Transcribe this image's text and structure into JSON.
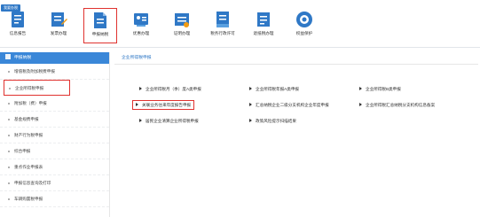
{
  "corner_tag": "我要办税",
  "toolbar": [
    {
      "label": "信息报告",
      "icon": "info-report-icon"
    },
    {
      "label": "发票办理",
      "icon": "invoice-icon"
    },
    {
      "label": "申报纳税",
      "icon": "tax-declare-icon"
    },
    {
      "label": "优惠办理",
      "icon": "preferential-icon"
    },
    {
      "label": "证明办理",
      "icon": "certificate-icon"
    },
    {
      "label": "税务行政许可",
      "icon": "admin-license-icon"
    },
    {
      "label": "退抵税办理",
      "icon": "refund-icon"
    },
    {
      "label": "权益保护",
      "icon": "rights-protection-icon"
    }
  ],
  "sidebar": {
    "title": "申报纳税",
    "items": [
      {
        "label": "增值税及附加税费申报"
      },
      {
        "label": "企业所得税申报"
      },
      {
        "label": "附加税（费）申报"
      },
      {
        "label": "基金规费申报"
      },
      {
        "label": "财产行为税申报"
      },
      {
        "label": "综合申报"
      },
      {
        "label": "重点作业申报表"
      },
      {
        "label": "申报信息查询及打印"
      },
      {
        "label": "车辆购置税申报"
      }
    ]
  },
  "main": {
    "title": "企业所得税申报",
    "links": [
      {
        "label": "企业所得税月（季）度A类申报"
      },
      {
        "label": "企业所得税年报A类申报"
      },
      {
        "label": "企业所得税B类申报"
      },
      {
        "label": "关联业务往来年度报告申报"
      },
      {
        "label": "汇总纳税企业二级分支机构企业年度申报"
      },
      {
        "label": "企业所得税汇总纳税分支机构信息备案"
      },
      {
        "label": "居民企业清算企业所得税申报"
      },
      {
        "label": "政策风险提示扫描结果"
      }
    ]
  },
  "colors": {
    "accent": "#2f78c6",
    "sidebar_head": "#3a87d8",
    "highlight": "#e0322f"
  }
}
